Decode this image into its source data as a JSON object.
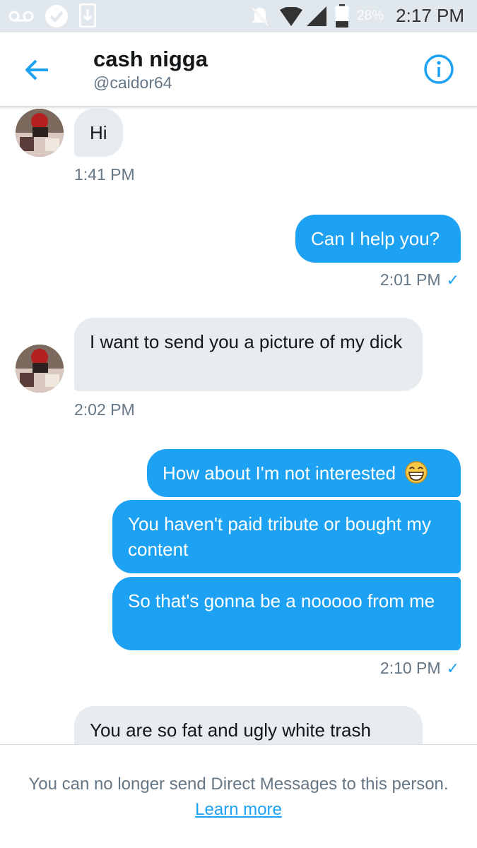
{
  "status_bar": {
    "time": "2:17 PM",
    "battery_percent": "28%",
    "icons": [
      "voicemail-icon",
      "check-circle-icon",
      "download-icon",
      "notifications-off-icon",
      "wifi-icon",
      "cell-signal-icon",
      "battery-icon"
    ]
  },
  "header": {
    "name": "cash nigga",
    "handle": "@caidor64",
    "back_icon": "arrow-left-icon",
    "info_icon": "info-circle-icon"
  },
  "messages": [
    {
      "side": "in",
      "text": "Hi"
    },
    {
      "side": "in",
      "timestamp": "1:41 PM"
    },
    {
      "side": "out",
      "text": "Can I help you?"
    },
    {
      "side": "out",
      "timestamp": "2:01 PM",
      "read_check": "✓"
    },
    {
      "side": "in",
      "text": "I want to send you a picture of my dick"
    },
    {
      "side": "in",
      "timestamp": "2:02 PM"
    },
    {
      "side": "out",
      "text": "How about I'm not interested",
      "emoji": "grinning-face-emoji"
    },
    {
      "side": "out",
      "text": "You haven't paid tribute or bought my content"
    },
    {
      "side": "out",
      "text": "So that's gonna be a nooooo from me"
    },
    {
      "side": "out",
      "timestamp": "2:10 PM",
      "read_check": "✓"
    },
    {
      "side": "in",
      "text": "You are so fat and ugly white trash"
    }
  ],
  "footer": {
    "notice": "You can no longer send Direct Messages to this person.",
    "link": "Learn more"
  },
  "colors": {
    "accent": "#1da1f2",
    "incoming_bubble": "#e6ecf0",
    "status_bar": "#e1e8ed",
    "secondary_text": "#657786"
  }
}
